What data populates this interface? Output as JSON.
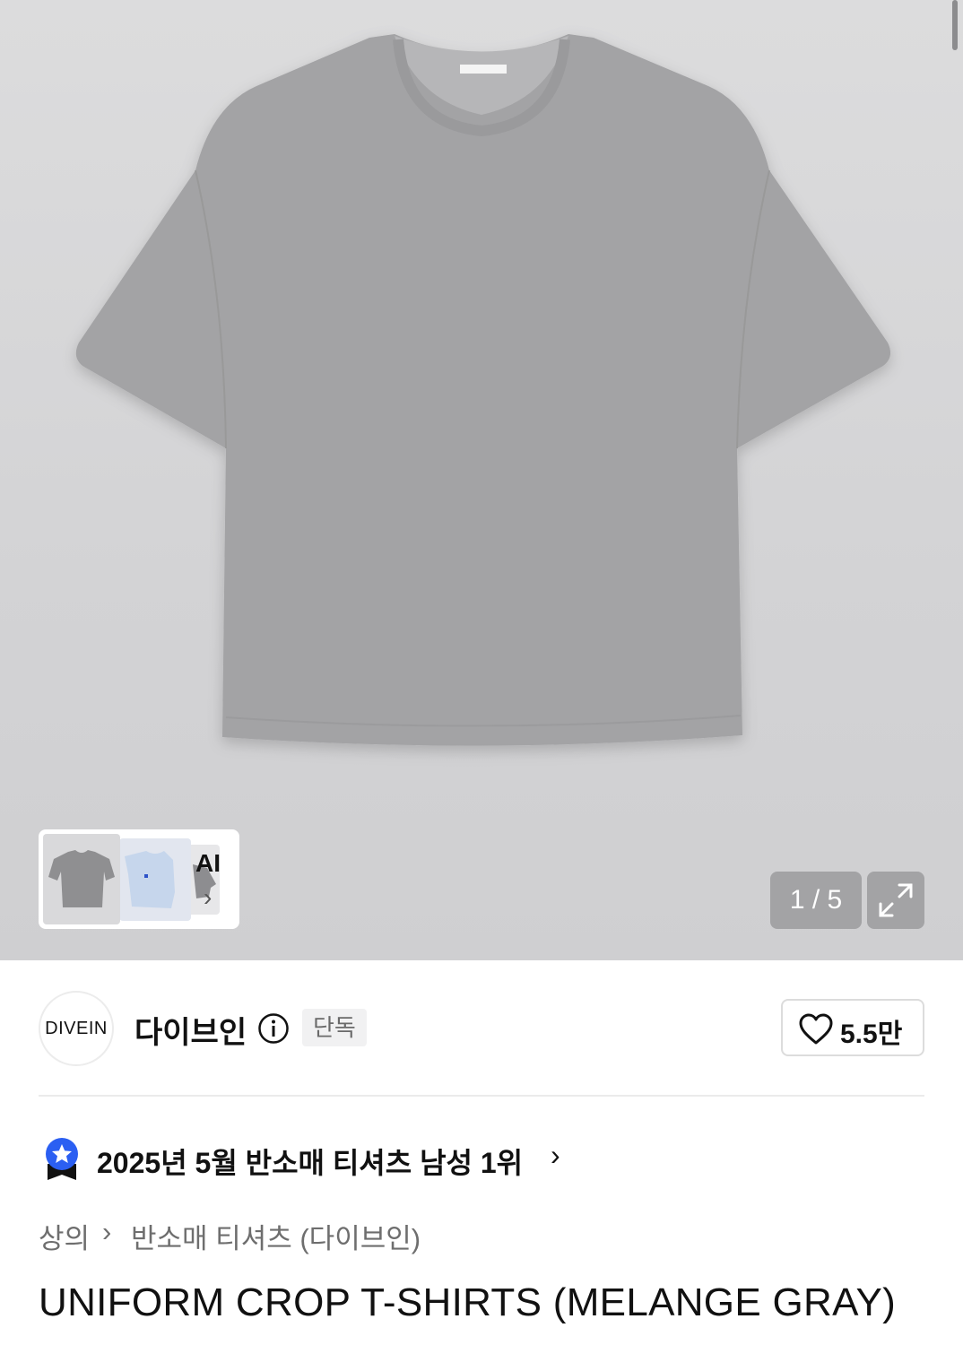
{
  "gallery": {
    "ai_label": "AI",
    "ai_chevron": "›",
    "counter": "1 / 5",
    "current_page": 1,
    "total_pages": 5,
    "icons": [
      "shirt-image",
      "expand-icon",
      "chevron-right-icon"
    ]
  },
  "brand": {
    "logo_text": "DIVEIN",
    "name": "다이브인",
    "badge": "단독",
    "like_count": "5.5만",
    "icons": [
      "info-icon",
      "heart-icon"
    ]
  },
  "ranking": {
    "text": "2025년 5월 반소매 티셔츠 남성 1위",
    "chevron": "›",
    "icon": "ranking-badge-icon",
    "badge_color": "#2b5ff2"
  },
  "breadcrumb": {
    "level1": "상의",
    "separator": "›",
    "level2": "반소매 티셔츠 (다이브인)"
  },
  "product": {
    "title": "UNIFORM CROP T-SHIRTS (MELANGE GRAY)"
  }
}
